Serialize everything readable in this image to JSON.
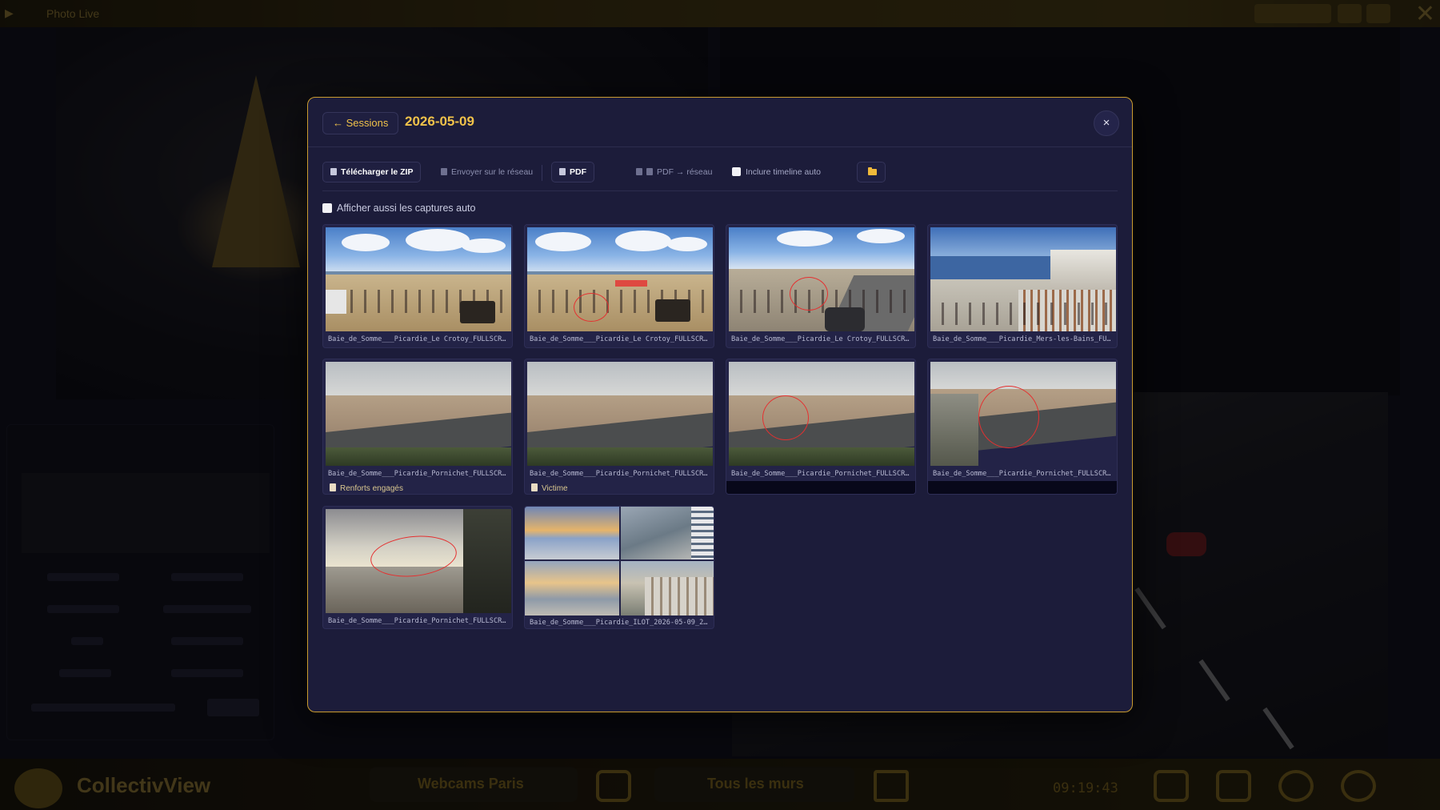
{
  "background": {
    "top_title": "Photo Live",
    "app_name": "CollectivView",
    "bottom_chip_1": "Webcams Paris",
    "bottom_chip_2": "Tous les murs",
    "clock": "09:19:43"
  },
  "modal": {
    "back_label": "← Sessions",
    "title": "2026-05-09",
    "close_label": "×"
  },
  "toolbar": {
    "download_zip": "Télécharger le ZIP",
    "send_network": "Envoyer sur le réseau",
    "pdf": "PDF",
    "pdf_network": "PDF → réseau",
    "include_timeline": "Inclure timeline auto"
  },
  "auto_captures_label": "Afficher aussi les captures auto",
  "gallery": [
    {
      "filename": "Baie_de_Somme___Picardie_Le Crotoy_FULLSCR…",
      "tag": ""
    },
    {
      "filename": "Baie_de_Somme___Picardie_Le Crotoy_FULLSCR…",
      "tag": ""
    },
    {
      "filename": "Baie_de_Somme___Picardie_Le Crotoy_FULLSCR…",
      "tag": ""
    },
    {
      "filename": "Baie_de_Somme___Picardie_Mers-les-Bains_FU…",
      "tag": ""
    },
    {
      "filename": "Baie_de_Somme___Picardie_Pornichet_FULLSCR…",
      "tag": "Renforts engagés"
    },
    {
      "filename": "Baie_de_Somme___Picardie_Pornichet_FULLSCR…",
      "tag": "Victime"
    },
    {
      "filename": "Baie_de_Somme___Picardie_Pornichet_FULLSCR…",
      "tag": ""
    },
    {
      "filename": "Baie_de_Somme___Picardie_Pornichet_FULLSCR…",
      "tag": ""
    },
    {
      "filename": "Baie_de_Somme___Picardie_Pornichet_FULLSCR…",
      "tag": ""
    },
    {
      "filename": "Baie_de_Somme___Picardie_ILOT_2026-05-09_2…",
      "tag": ""
    }
  ],
  "colors": {
    "accent": "#f0c24a",
    "modal_bg": "#1c1c3a",
    "modal_border": "#c99b2f",
    "annotation": "#e53030"
  }
}
